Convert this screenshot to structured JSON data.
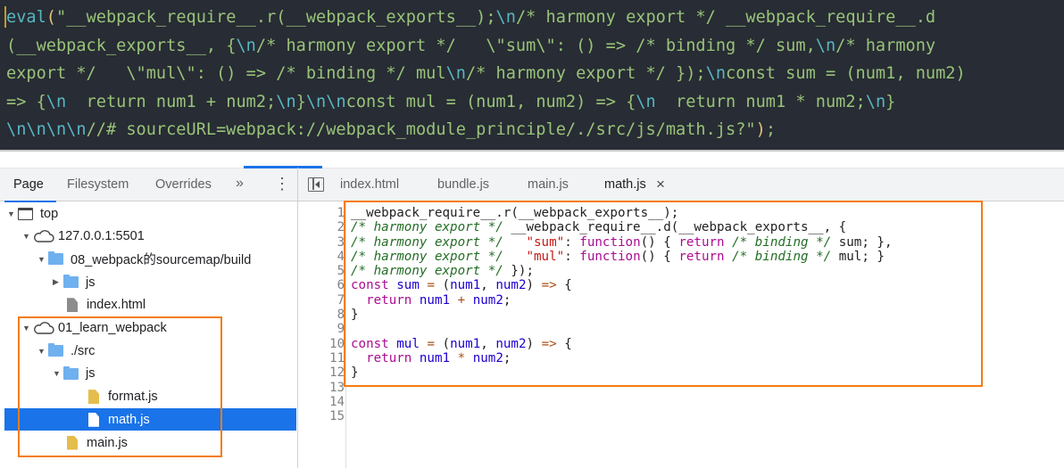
{
  "bundle_code": {
    "lines": [
      "eval(\"__webpack_require__.r(__webpack_exports__);\\n/* harmony export */ __webpack_require__.d",
      "(__webpack_exports__, {\\n/* harmony export */   \\\"sum\\\": () => /* binding */ sum,\\n/* harmony",
      "export */   \\\"mul\\\": () => /* binding */ mul\\n/* harmony export */ });\\nconst sum = (num1, num2)",
      "=> {\\n  return num1 + num2;\\n}\\n\\nconst mul = (num1, num2) => {\\n  return num1 * num2;\\n}",
      "\\n\\n\\n\\n//# sourceURL=webpack://webpack_module_principle/./src/js/math.js?\");"
    ]
  },
  "navigator": {
    "tabs": [
      "Page",
      "Filesystem",
      "Overrides"
    ],
    "active_tab": "Page",
    "more_icon": "»",
    "menu_icon": "⋮",
    "tree": [
      {
        "label": "top",
        "icon": "frame",
        "depth": 0,
        "expanded": true
      },
      {
        "label": "127.0.0.1:5501",
        "icon": "cloud",
        "depth": 1,
        "expanded": true
      },
      {
        "label": "08_webpack的sourcemap/build",
        "icon": "folder",
        "depth": 2,
        "expanded": true
      },
      {
        "label": "js",
        "icon": "folder",
        "depth": 3,
        "expanded": false
      },
      {
        "label": "index.html",
        "icon": "file-gray",
        "depth": 3
      },
      {
        "label": "01_learn_webpack",
        "icon": "cloud",
        "depth": 1,
        "expanded": true
      },
      {
        "label": "./src",
        "icon": "folder",
        "depth": 2,
        "expanded": true
      },
      {
        "label": "js",
        "icon": "folder",
        "depth": 3,
        "expanded": true
      },
      {
        "label": "format.js",
        "icon": "file-yellow",
        "depth": 4
      },
      {
        "label": "math.js",
        "icon": "file-white",
        "depth": 4,
        "selected": true
      },
      {
        "label": "main.js",
        "icon": "file-yellow",
        "depth": 3
      }
    ]
  },
  "editor": {
    "file_tabs": [
      "index.html",
      "bundle.js",
      "main.js",
      "math.js"
    ],
    "active_tab": "math.js",
    "close_icon": "×",
    "line_numbers": [
      "1",
      "2",
      "3",
      "4",
      "5",
      "6",
      "7",
      "8",
      "9",
      "10",
      "11",
      "12",
      "13",
      "14",
      "15"
    ],
    "lines": [
      [
        [
          "__webpack_require__.r(__webpack_exports__);",
          "p"
        ]
      ],
      [
        [
          "/* harmony export */",
          "c"
        ],
        [
          " __webpack_require__.d(__webpack_exports__, {",
          "p"
        ]
      ],
      [
        [
          "/* harmony export */",
          "c"
        ],
        [
          "   ",
          "p"
        ],
        [
          "\"sum\"",
          "s"
        ],
        [
          ": ",
          "p"
        ],
        [
          "function",
          "k"
        ],
        [
          "() { ",
          "p"
        ],
        [
          "return",
          "k"
        ],
        [
          " ",
          "p"
        ],
        [
          "/* binding */",
          "c"
        ],
        [
          " sum; },",
          "p"
        ]
      ],
      [
        [
          "/* harmony export */",
          "c"
        ],
        [
          "   ",
          "p"
        ],
        [
          "\"mul\"",
          "s"
        ],
        [
          ": ",
          "p"
        ],
        [
          "function",
          "k"
        ],
        [
          "() { ",
          "p"
        ],
        [
          "return",
          "k"
        ],
        [
          " ",
          "p"
        ],
        [
          "/* binding */",
          "c"
        ],
        [
          " mul; }",
          "p"
        ]
      ],
      [
        [
          "/* harmony export */",
          "c"
        ],
        [
          " });",
          "p"
        ]
      ],
      [
        [
          "const",
          "k"
        ],
        [
          " ",
          "p"
        ],
        [
          "sum",
          "v"
        ],
        [
          " ",
          "p"
        ],
        [
          "=",
          "o"
        ],
        [
          " (",
          "p"
        ],
        [
          "num1",
          "v"
        ],
        [
          ", ",
          "p"
        ],
        [
          "num2",
          "v"
        ],
        [
          ") ",
          "p"
        ],
        [
          "=>",
          "o"
        ],
        [
          " {",
          "p"
        ]
      ],
      [
        [
          "  ",
          "p"
        ],
        [
          "return",
          "k"
        ],
        [
          " ",
          "p"
        ],
        [
          "num1",
          "v"
        ],
        [
          " ",
          "p"
        ],
        [
          "+",
          "o"
        ],
        [
          " ",
          "p"
        ],
        [
          "num2",
          "v"
        ],
        [
          ";",
          "p"
        ]
      ],
      [
        [
          "}",
          "p"
        ]
      ],
      [],
      [
        [
          "const",
          "k"
        ],
        [
          " ",
          "p"
        ],
        [
          "mul",
          "v"
        ],
        [
          " ",
          "p"
        ],
        [
          "=",
          "o"
        ],
        [
          " (",
          "p"
        ],
        [
          "num1",
          "v"
        ],
        [
          ", ",
          "p"
        ],
        [
          "num2",
          "v"
        ],
        [
          ") ",
          "p"
        ],
        [
          "=>",
          "o"
        ],
        [
          " {",
          "p"
        ]
      ],
      [
        [
          "  ",
          "p"
        ],
        [
          "return",
          "k"
        ],
        [
          " ",
          "p"
        ],
        [
          "num1",
          "v"
        ],
        [
          " ",
          "p"
        ],
        [
          "*",
          "o"
        ],
        [
          " ",
          "p"
        ],
        [
          "num2",
          "v"
        ],
        [
          ";",
          "p"
        ]
      ],
      [
        [
          "}",
          "p"
        ]
      ],
      [],
      [],
      []
    ]
  },
  "colors": {
    "accent": "#1a73e8",
    "highlight_box": "#f57c10",
    "dark_bg": "#282c34"
  }
}
